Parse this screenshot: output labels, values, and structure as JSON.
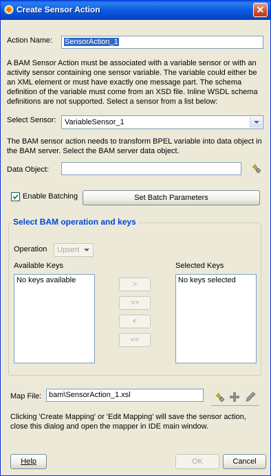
{
  "window": {
    "title": "Create Sensor Action",
    "close_glyph": "✕"
  },
  "action_name": {
    "label": "Action Name:",
    "value": "SensorAction_1"
  },
  "intro_text": [
    "A BAM Sensor Action must be associated with a variable sensor or with an",
    "activity sensor containing one sensor variable. The variable could either be",
    "an XML element or must have exactly one message part. The schema",
    "definition of the variable must come from an XSD file. Inline WSDL schema",
    "definitions are not supported. Select a sensor from a list below:"
  ],
  "select_sensor": {
    "label": "Select Sensor:",
    "value": "VariableSensor_1"
  },
  "bam_text": [
    "The BAM sensor action needs to transform BPEL variable into data object in",
    "the BAM server. Select the BAM server data object."
  ],
  "data_object": {
    "label": "Data Object:",
    "value": "",
    "browse_icon": "flashlight-icon"
  },
  "batching": {
    "label": "Enable Batching",
    "checked": true,
    "set_params_label": "Set Batch Parameters"
  },
  "bam_operation": {
    "group_title": "Select BAM operation and keys",
    "operation_label": "Operation",
    "operation_value": "Upsert",
    "available_keys_label": "Available Keys",
    "available_keys_items": [
      "No keys available"
    ],
    "selected_keys_label": "Selected Keys",
    "selected_keys_items": [
      "No keys selected"
    ],
    "move_buttons": [
      ">",
      ">>",
      "<",
      "<<"
    ]
  },
  "map_file": {
    "label": "Map File:",
    "value": "bam\\SensorAction_1.xsl",
    "icons": [
      "flashlight-icon",
      "add-icon",
      "edit-pencil-icon"
    ]
  },
  "mapping_note": [
    "Clicking 'Create Mapping' or 'Edit Mapping' will save the sensor action,",
    "close this dialog and open the mapper in IDE main window."
  ],
  "footer": {
    "help_label": "Help",
    "ok_label": "OK",
    "cancel_label": "Cancel"
  }
}
